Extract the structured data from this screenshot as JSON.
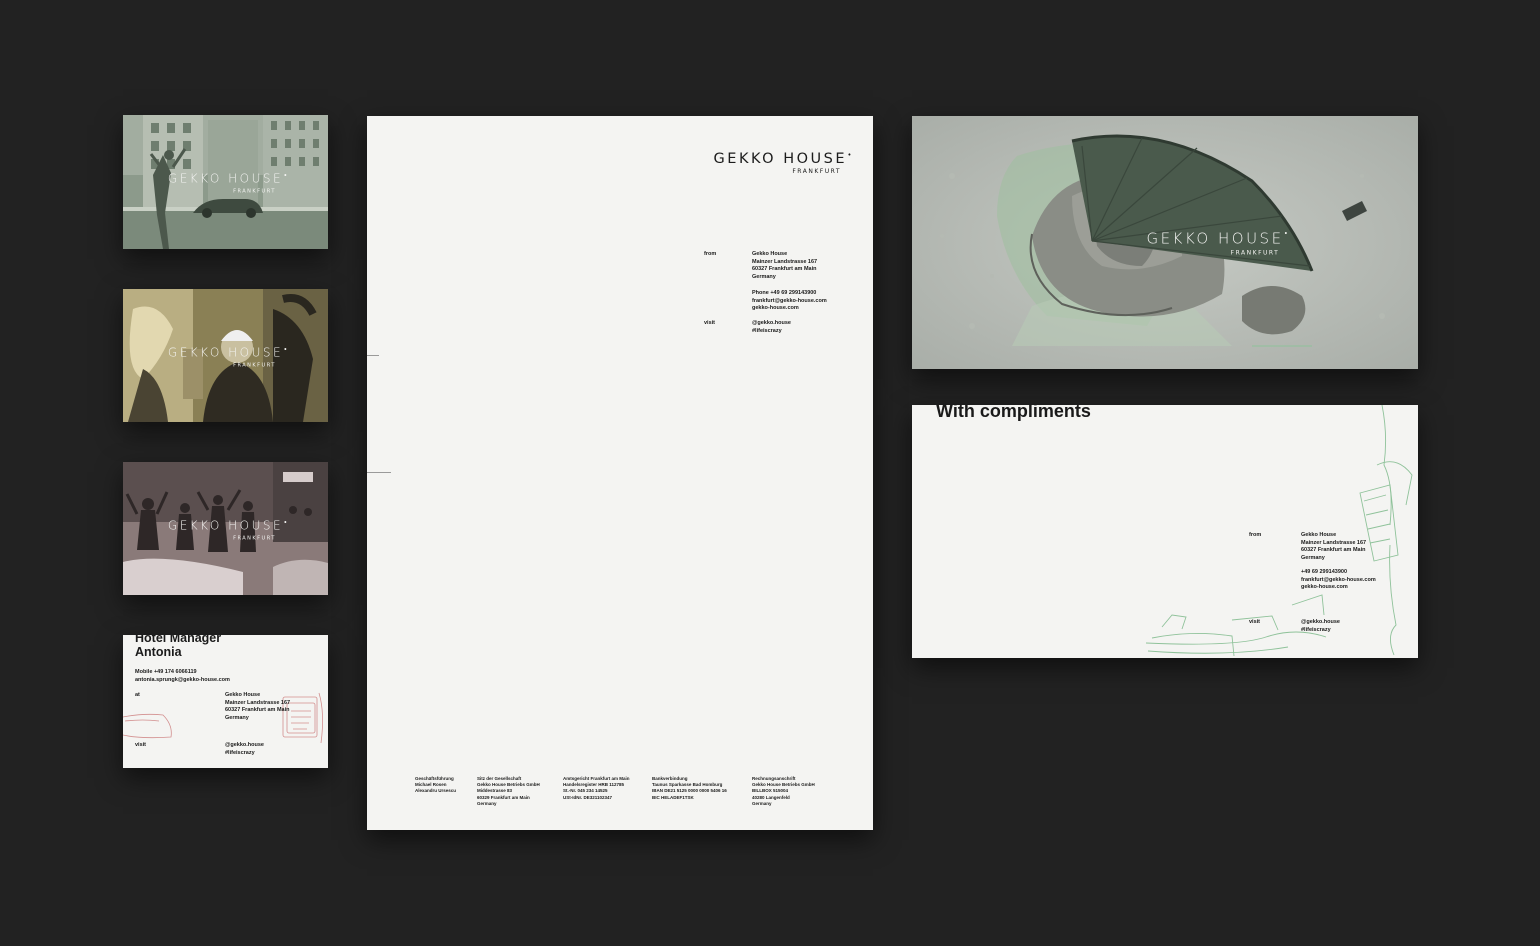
{
  "brand": {
    "name": "GEKKO HOUSE",
    "mark": "•",
    "city": "FRANKFURT"
  },
  "colors": {
    "background": "#222222",
    "paper": "#f4f4f2",
    "sage": "#8fa390",
    "sketch_green": "#8fc29a",
    "sketch_red": "#d28e8e"
  },
  "business_card": {
    "title": "Hotel Manager",
    "name": "Antonia",
    "mobile": "Mobile +49 174 6066119",
    "email": "antonia.sprungk@gekko-house.com",
    "at_label": "at",
    "address": "Gekko House\nMainzer Landstrasse 167\n60327 Frankfurt am Main\nGermany",
    "visit_label": "visit",
    "social": "@gekko.house\n#lifeiscrazy"
  },
  "letterhead": {
    "from_label": "from",
    "address": "Gekko House\nMainzer Landstrasse 167\n60327 Frankfurt am Main\nGermany",
    "contact": "Phone +49 69 299143900\nfrankfurt@gekko-house.com\ngekko-house.com",
    "visit_label": "visit",
    "social": "@gekko.house\n#lifeiscrazy",
    "footer": [
      "Geschäftsführung\nMichael Rosen\nAlexandru Ursescu",
      "Sitz der Gesellschaft\nGekko House Betriebs GmbH\nMiddestrasse 83\n60329 Frankfurt am Main\nGermany",
      "Amtsgericht Frankfurt am Main\nHandelsregister HRB 112785\nSt.-Nr. 045 234 14525\nUSt-IdNr. DE321102347",
      "Bankverbindung\nTaunus Sparkasse Bad Homburg\nIBAN DE21 5125 0000 0000 5406 16\nBIC HELADEF1TSK",
      "Rechnungsanschrift\nGekko House Betriebs GmbH\nBILLBOX 515004\n40280 Langenfeld\nGermany"
    ]
  },
  "compliments": {
    "title": "With compliments",
    "from_label": "from",
    "address": "Gekko House\nMainzer Landstrasse 167\n60327 Frankfurt am Main\nGermany",
    "contact": "+49 69 299143900\nfrankfurt@gekko-house.com\ngekko-house.com",
    "visit_label": "visit",
    "social": "@gekko.house\n#lifeiscrazy"
  }
}
